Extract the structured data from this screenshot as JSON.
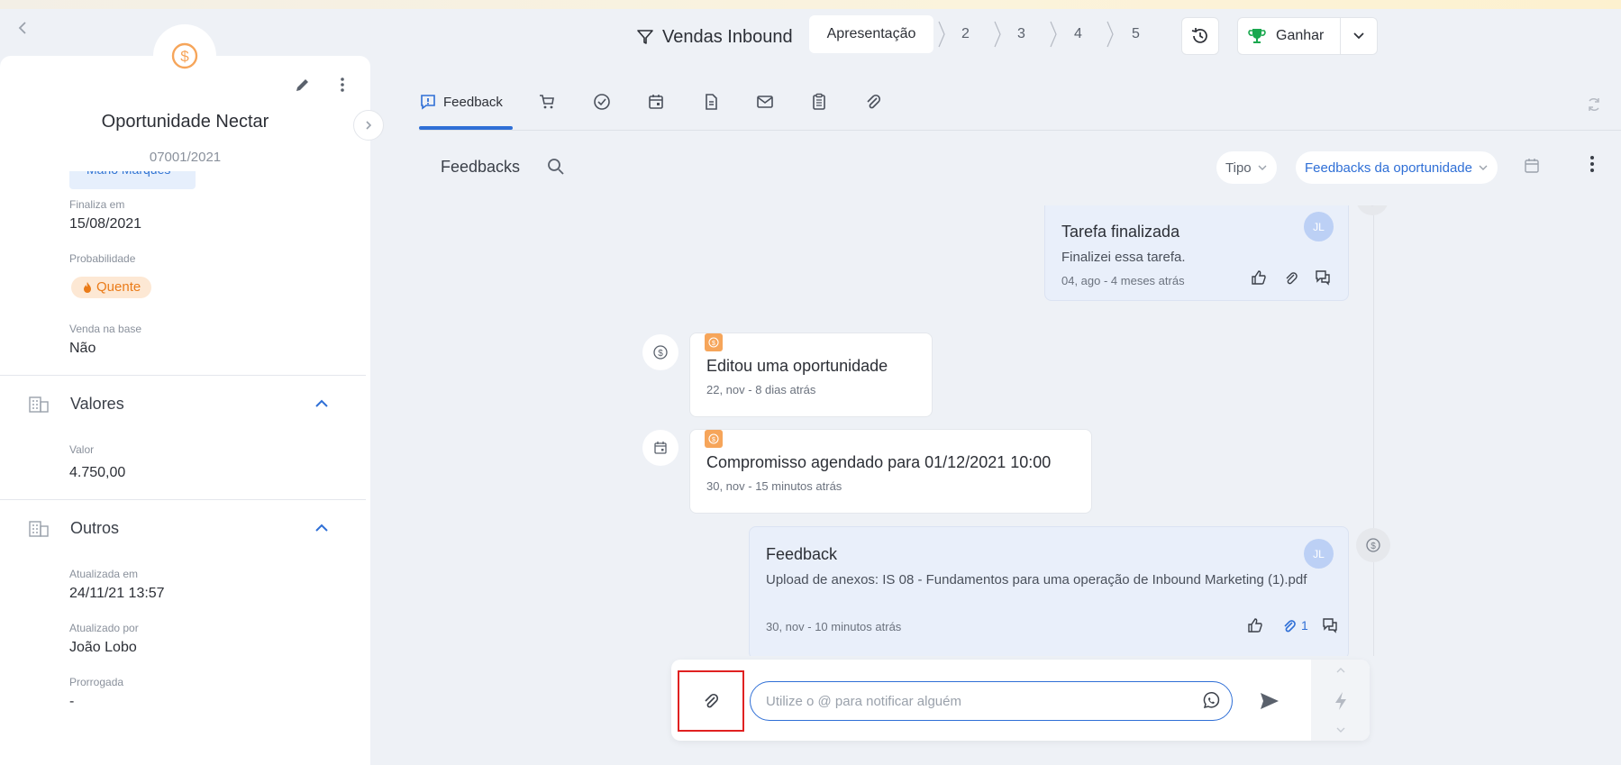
{
  "colors": {
    "accent": "#2f6fd6",
    "orange": "#f6a55a",
    "hot": "#ea7b18",
    "trophy": "#1aa84f",
    "highlight": "#e02121"
  },
  "nav": {
    "back_icon": "chevron-left-icon"
  },
  "opportunity": {
    "title": "Oportunidade Nectar",
    "code": "07001/2021",
    "responsible_chip": "Mario Marques",
    "fields": {
      "finaliza_label": "Finaliza em",
      "finaliza_value": "15/08/2021",
      "probabilidade_label": "Probabilidade",
      "probabilidade_value": "Quente",
      "venda_label": "Venda na base",
      "venda_value": "Não"
    },
    "sections": {
      "valores_title": "Valores",
      "valor_label": "Valor",
      "valor_value": "4.750,00",
      "outros_title": "Outros",
      "atualizada_label": "Atualizada em",
      "atualizada_value": "24/11/21 13:57",
      "atualizado_por_label": "Atualizado por",
      "atualizado_por_value": "João Lobo",
      "prorrogada_label": "Prorrogada",
      "prorrogada_value": "-"
    }
  },
  "header": {
    "pipeline": "Vendas Inbound",
    "stages": [
      "Apresentação",
      "2",
      "3",
      "4",
      "5"
    ],
    "win_label": "Ganhar"
  },
  "tabs": [
    {
      "label": "Feedback",
      "icon": "feedback-icon"
    },
    {
      "label": "",
      "icon": "cart-icon"
    },
    {
      "label": "",
      "icon": "check-circle-icon"
    },
    {
      "label": "",
      "icon": "calendar-icon"
    },
    {
      "label": "",
      "icon": "document-icon"
    },
    {
      "label": "",
      "icon": "mail-icon"
    },
    {
      "label": "",
      "icon": "clipboard-icon"
    },
    {
      "label": "",
      "icon": "paperclip-icon"
    }
  ],
  "feed": {
    "title": "Feedbacks",
    "filter_type": "Tipo",
    "filter_scope": "Feedbacks da oportunidade",
    "items": [
      {
        "title": "Tarefa finalizada",
        "text": "Finalizei essa tarefa.",
        "time": "04, ago - 4 meses atrás",
        "avatar": "JL"
      },
      {
        "title": "Editou uma oportunidade",
        "time": "22, nov - 8 dias atrás"
      },
      {
        "title": "Compromisso agendado para 01/12/2021 10:00",
        "time": "30, nov - 15 minutos atrás"
      },
      {
        "title": "Feedback",
        "text": "Upload de anexos: IS 08 - Fundamentos para uma operação de Inbound Marketing (1).pdf",
        "time": "30, nov - 10 minutos atrás",
        "avatar": "JL",
        "attachments": "1"
      }
    ]
  },
  "composer": {
    "placeholder": "Utilize o @ para notificar alguém"
  }
}
